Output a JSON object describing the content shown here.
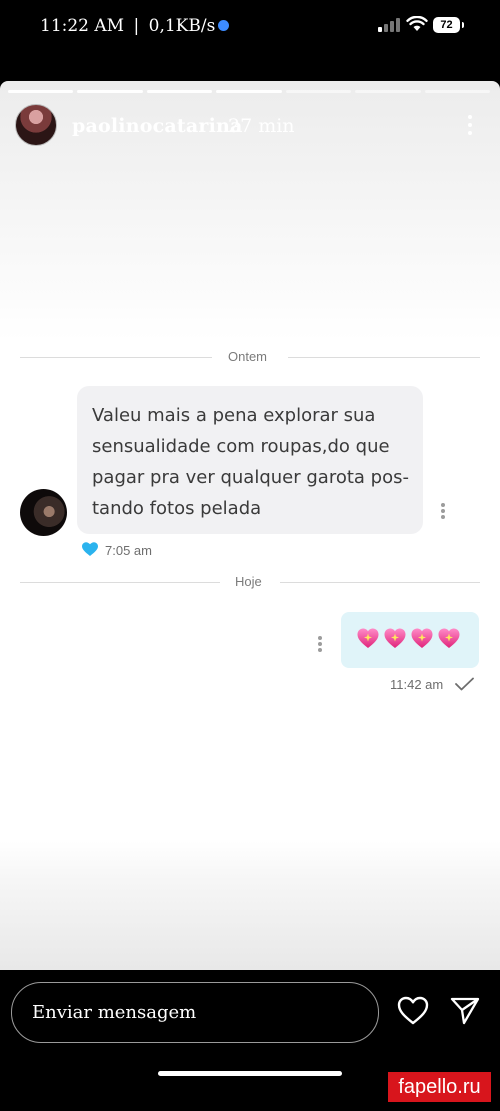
{
  "status_bar": {
    "time": "11:22 AM",
    "separator": "|",
    "speed": "0,1KB/s",
    "battery": "72"
  },
  "story": {
    "progress": {
      "total_segments": 7,
      "active_segment": 4
    },
    "username": "paolinocatarina",
    "time_ago": "27 min"
  },
  "chat": {
    "divider_yesterday": "Ontem",
    "divider_today": "Hoje",
    "incoming": {
      "text": "Valeu mais a pena explorar sua sensualidade com roupas,do que pagar pra ver qualquer garota pos-tando fotos pelada",
      "reaction_icon": "blue-heart-icon",
      "time": "7:05 am"
    },
    "outgoing": {
      "emoji": "💖💖💖💖",
      "time": "11:42 am",
      "status_icon": "checkmark-icon"
    }
  },
  "reply_bar": {
    "placeholder": "Enviar mensagem"
  },
  "watermark": "fapello.ru",
  "colors": {
    "outgoing_bubble": "#e0f4f9",
    "incoming_bubble": "#f1f1f3",
    "reaction_heart": "#2bb3ee",
    "watermark_bg": "#d8151c"
  }
}
